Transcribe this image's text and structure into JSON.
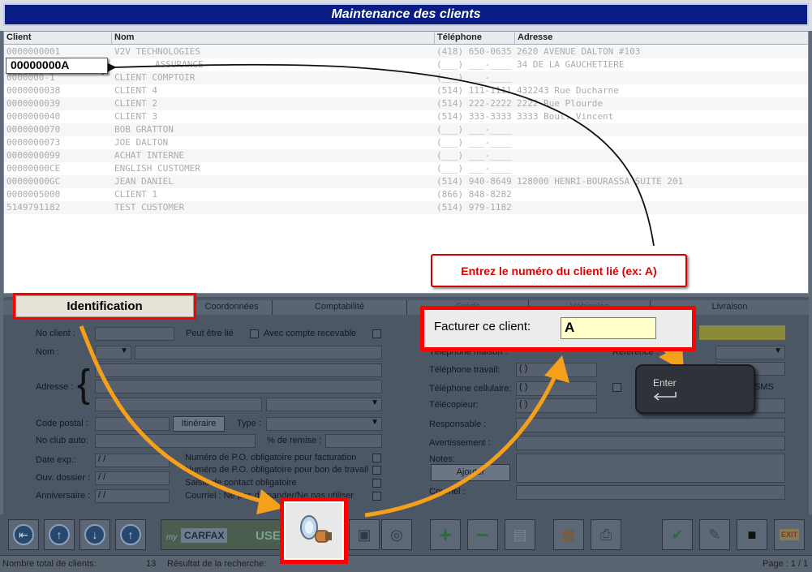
{
  "window": {
    "title": "Maintenance des clients"
  },
  "grid": {
    "columns": [
      "Client",
      "Nom",
      "Téléphone",
      "Adresse"
    ],
    "rows": [
      {
        "client": "0000000001",
        "nom": "V2V TECHNOLOGIES",
        "tel": "(418) 650-0635",
        "adresse": "2620 AVENUE DALTON #103"
      },
      {
        "client": "",
        "nom": "ASSURANCE",
        "tel": "(___) ___-____",
        "adresse": "34 DE LA GAUCHETIERE"
      },
      {
        "client": "0000000-1",
        "nom": "CLIENT COMPTOIR",
        "tel": "(___) ___-____",
        "adresse": ""
      },
      {
        "client": "0000000038",
        "nom": "CLIENT 4",
        "tel": "(514) 111-1111",
        "adresse": "432243 Rue Ducharne"
      },
      {
        "client": "0000000039",
        "nom": "CLIENT 2",
        "tel": "(514) 222-2222",
        "adresse": "2222 Rue Plourde"
      },
      {
        "client": "0000000040",
        "nom": "CLIENT 3",
        "tel": "(514) 333-3333",
        "adresse": "3333 Boul. Vincent"
      },
      {
        "client": "0000000070",
        "nom": "BOB GRATTON",
        "tel": "(___) ___-____",
        "adresse": ""
      },
      {
        "client": "0000000073",
        "nom": "JOE DALTON",
        "tel": "(___) ___-____",
        "adresse": ""
      },
      {
        "client": "0000000099",
        "nom": "ACHAT INTERNE",
        "tel": "(___) ___-____",
        "adresse": ""
      },
      {
        "client": "00000000CE",
        "nom": "ENGLISH CUSTOMER",
        "tel": "(___) ___-____",
        "adresse": ""
      },
      {
        "client": "00000000GC",
        "nom": "JEAN DANIEL",
        "tel": "(514) 940-8649",
        "adresse": "128000 HENRI-BOURASSA SUITE 201"
      },
      {
        "client": "0000005000",
        "nom": "CLIENT 1",
        "tel": "(866) 848-8282",
        "adresse": ""
      },
      {
        "client": "5149791182",
        "nom": "TEST CUSTOMER",
        "tel": "(514) 979-1182",
        "adresse": ""
      }
    ]
  },
  "tabs": [
    "Identification",
    "Coordonnées",
    "Comptabilité",
    "Crédit",
    "Véhicules",
    "Livraison"
  ],
  "form": {
    "no_client": "No client :",
    "peut_etre_lie": "Peut être lié",
    "avec_compte": "Avec compte recevable",
    "nom": "Nom :",
    "adresse": "Adresse :",
    "code_postal": "Code postal :",
    "itineraire": "Itinéraire",
    "type": "Type :",
    "no_club": "No club auto:",
    "remise": "% de remise :",
    "date_exp": "Date exp.:",
    "ouv_dossier": "Ouv. dossier :",
    "anniversaire": "Anniversaire :",
    "date_placeholder": "/ /",
    "po_facturation": "Numéro de P.O. obligatoire pour facturation",
    "po_bon": "Numéro de P.O. obligatoire pour bon de travail",
    "saisie_contact": "Saisie de contact obligatoire",
    "courriel_ne_pas": "Courriel : Ne pas demander/Ne pas utiliser",
    "tel_maison": "Téléphone maison :",
    "tel_travail": "Téléphone travail:",
    "tel_cellulaire": "Téléphone cellulaire:",
    "telecopieur": "Télécopieur:",
    "responsable": "Responsable :",
    "avertissement": "Avertissement :",
    "notes": "Notes:",
    "ajouter": "Ajouter",
    "courriel": "Courriel :",
    "reference": "Référence :",
    "sms": "SMS",
    "paren": "( )"
  },
  "toolbar": {
    "carfax": "CARFAX",
    "carfax_prefix": "my",
    "use_label": "USE",
    "exit_label": "EXIT"
  },
  "status": {
    "total_label": "Nombre total de clients:",
    "total_value": "13",
    "search_label": "Résultat de la recherche:",
    "page": "Page : 1 / 1"
  },
  "annotations": {
    "client_input": "00000000A",
    "ident_tab": "Identification",
    "facturer_label": "Facturer ce client:",
    "facturer_value": "A",
    "instruction": "Entrez le numéro du client lié (ex: A)",
    "enter_key": "Enter"
  },
  "colors": {
    "title_bar": "#0a1d84",
    "callout_red": "#ff0000",
    "arrow_orange": "#f5a01a",
    "instruction_text": "#e00000"
  }
}
